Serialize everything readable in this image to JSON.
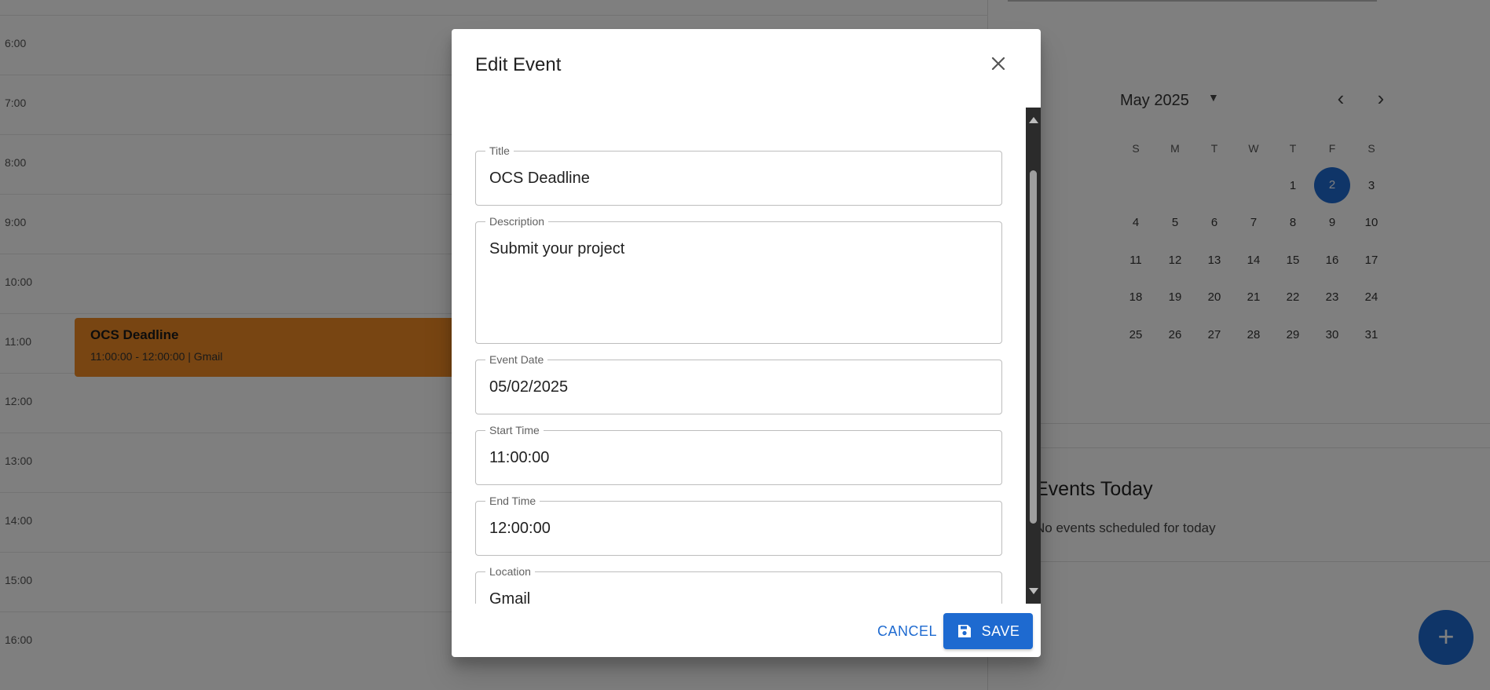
{
  "day_view": {
    "hours": [
      "6:00",
      "7:00",
      "8:00",
      "9:00",
      "10:00",
      "11:00",
      "12:00",
      "13:00",
      "14:00",
      "15:00",
      "16:00"
    ],
    "event": {
      "title": "OCS Deadline",
      "meta": "11:00:00 - 12:00:00 | Gmail",
      "color": "#f08a24"
    }
  },
  "mini_calendar": {
    "month_label": "May 2025",
    "weekdays": [
      "S",
      "M",
      "T",
      "W",
      "T",
      "F",
      "S"
    ],
    "weeks": [
      [
        "",
        "",
        "",
        "",
        "1",
        "2",
        "3"
      ],
      [
        "4",
        "5",
        "6",
        "7",
        "8",
        "9",
        "10"
      ],
      [
        "11",
        "12",
        "13",
        "14",
        "15",
        "16",
        "17"
      ],
      [
        "18",
        "19",
        "20",
        "21",
        "22",
        "23",
        "24"
      ],
      [
        "25",
        "26",
        "27",
        "28",
        "29",
        "30",
        "31"
      ]
    ],
    "selected_day": "2",
    "accent": "#1e6ad0"
  },
  "today_panel": {
    "title": "Events Today",
    "empty_text": "No events scheduled for today"
  },
  "fab": {
    "icon": "plus-icon",
    "label": "+"
  },
  "dialog": {
    "title": "Edit Event",
    "fields": {
      "title": {
        "label": "Title",
        "value": "OCS Deadline"
      },
      "description": {
        "label": "Description",
        "value": "Submit your project"
      },
      "event_date": {
        "label": "Event Date",
        "value": "05/02/2025"
      },
      "start_time": {
        "label": "Start Time",
        "value": "11:00:00"
      },
      "end_time": {
        "label": "End Time",
        "value": "12:00:00"
      },
      "location": {
        "label": "Location",
        "value": "Gmail"
      }
    },
    "actions": {
      "cancel_label": "CANCEL",
      "save_label": "SAVE",
      "save_icon": "save-icon"
    }
  }
}
